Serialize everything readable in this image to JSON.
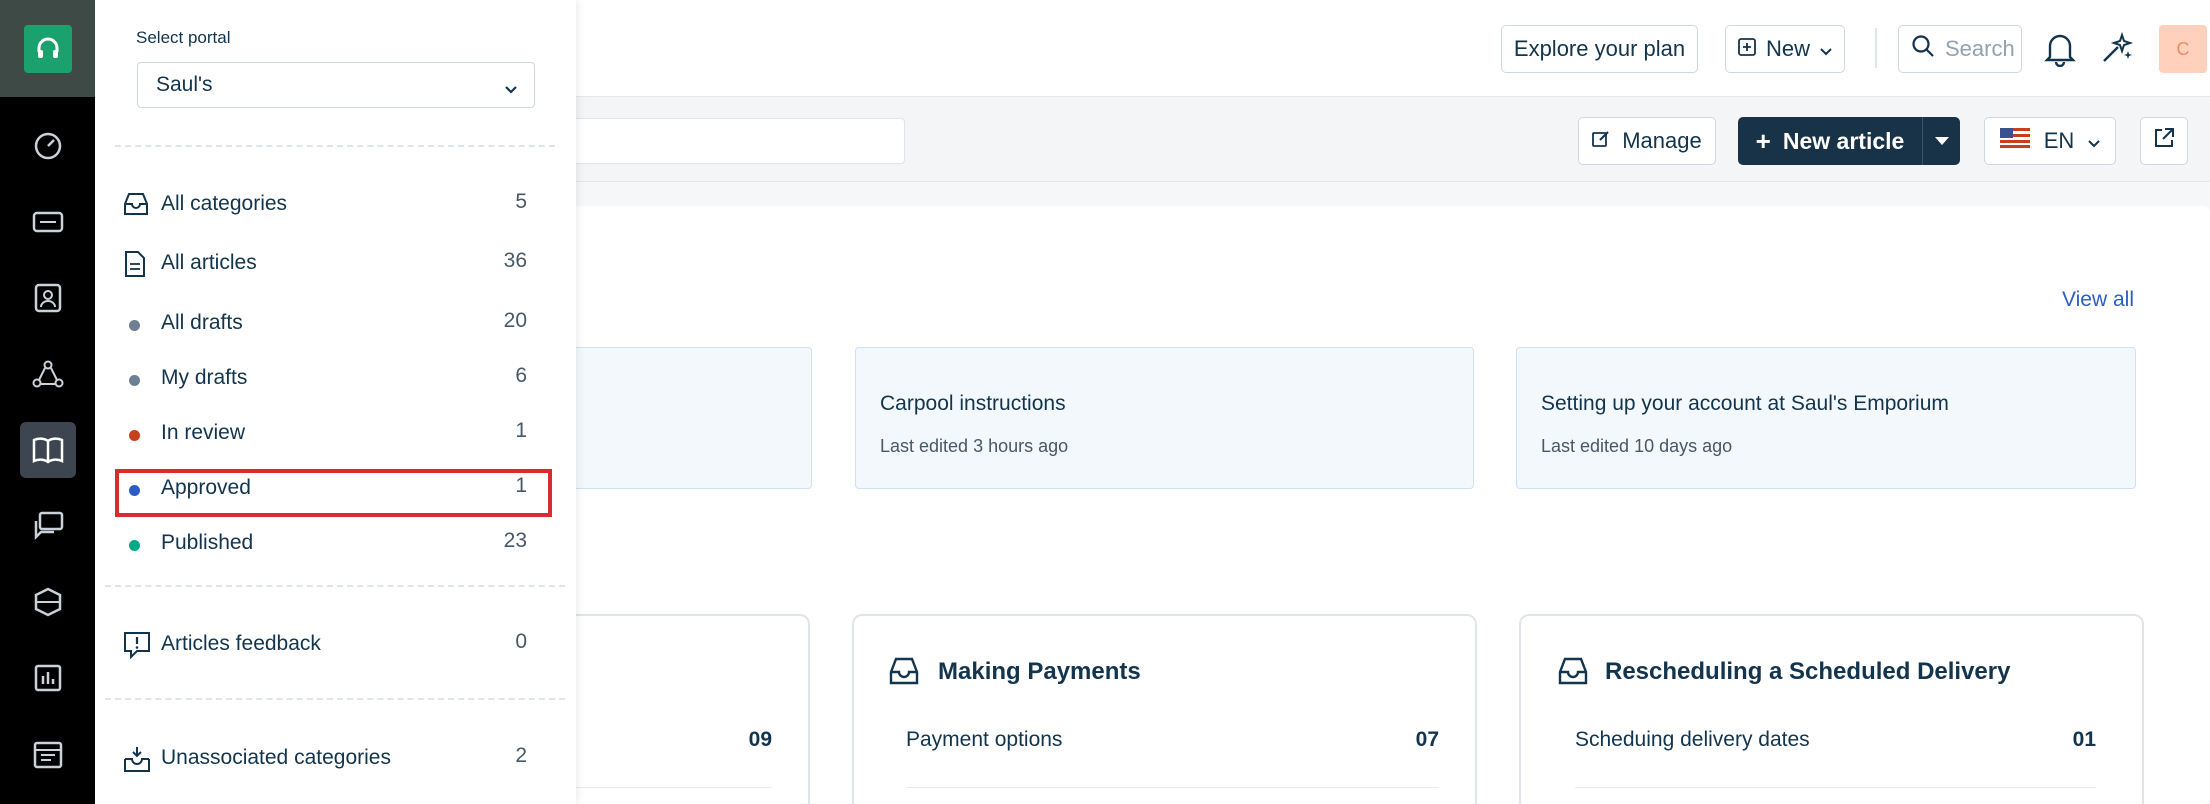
{
  "header": {
    "explore_label": "Explore your plan",
    "new_label": "New",
    "search_placeholder": "Search",
    "avatar_initial": "C"
  },
  "subheader": {
    "manage_label": "Manage",
    "new_article_label": "New article",
    "language": "EN"
  },
  "panel": {
    "select_portal_label": "Select portal",
    "portal_value": "Saul's",
    "items": [
      {
        "label": "All categories",
        "count": "5"
      },
      {
        "label": "All articles",
        "count": "36"
      },
      {
        "label": "All drafts",
        "count": "20",
        "dot": "#6e7f93"
      },
      {
        "label": "My drafts",
        "count": "6",
        "dot": "#6e7f93"
      },
      {
        "label": "In review",
        "count": "1",
        "dot": "#c8401b"
      },
      {
        "label": "Approved",
        "count": "1",
        "dot": "#2c5cc5"
      },
      {
        "label": "Published",
        "count": "23",
        "dot": "#00a886"
      },
      {
        "label": "Articles feedback",
        "count": "0"
      },
      {
        "label": "Unassociated categories",
        "count": "2"
      }
    ]
  },
  "main": {
    "view_all": "View all",
    "recent_cards": [
      {
        "title": "Carpool instructions",
        "sub": "Last edited 3 hours ago"
      },
      {
        "title": "Setting up your account at Saul's Emporium",
        "sub": "Last edited 10 days ago"
      }
    ],
    "categories": [
      {
        "title": "",
        "row_label": "",
        "row_count": "09"
      },
      {
        "title": "Making Payments",
        "row_label": "Payment options",
        "row_count": "07"
      },
      {
        "title": "Rescheduling a Scheduled Delivery",
        "row_label": "Scheduing delivery dates",
        "row_count": "01"
      }
    ]
  },
  "colors": {
    "brand": "#1ba16d",
    "primary": "#183247",
    "link": "#2c5cc5",
    "highlight": "#d72d30"
  }
}
